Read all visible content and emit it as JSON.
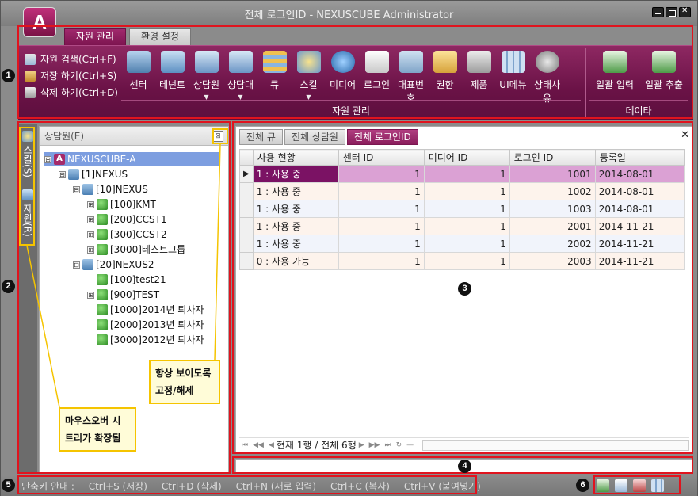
{
  "window": {
    "title": "전체 로그인ID - NEXUSCUBE Administrator",
    "logo": "A"
  },
  "main_tabs": [
    "자원 관리",
    "환경 설정"
  ],
  "ribbon": {
    "small_cmds": [
      "자원 검색(Ctrl+F)",
      "저장 하기(Ctrl+S)",
      "삭제 하기(Ctrl+D)"
    ],
    "big_buttons": [
      "센터",
      "테넌트",
      "상담원",
      "상담대",
      "큐",
      "스킬",
      "미디어",
      "로그인",
      "대표번호",
      "권한",
      "제품",
      "UI메뉴",
      "상태사유"
    ],
    "data_buttons": [
      "일괄 입력",
      "일괄 추출"
    ],
    "group_resource": "자원 관리",
    "group_data": "데이타"
  },
  "left_strip": {
    "skill": "스킬(S)",
    "resource": "자원(R)"
  },
  "tree_panel": {
    "title": "상담원(E)",
    "nodes": [
      {
        "label": "NEXUSCUBE-A",
        "exp": "⊟"
      },
      {
        "label": "[1]NEXUS",
        "exp": "⊟"
      },
      {
        "label": "[10]NEXUS",
        "exp": "⊟"
      },
      {
        "label": "[100]KMT",
        "exp": "⊞"
      },
      {
        "label": "[200]CCST1",
        "exp": "⊞"
      },
      {
        "label": "[300]CCST2",
        "exp": "⊞"
      },
      {
        "label": "[3000]테스트그룹",
        "exp": "⊞"
      },
      {
        "label": "[20]NEXUS2",
        "exp": "⊟"
      },
      {
        "label": "[100]test21",
        "exp": ""
      },
      {
        "label": "[900]TEST",
        "exp": "⊞"
      },
      {
        "label": "[1000]2014년 퇴사자",
        "exp": ""
      },
      {
        "label": "[2000]2013년 퇴사자",
        "exp": ""
      },
      {
        "label": "[3000]2012년 퇴사자",
        "exp": ""
      }
    ]
  },
  "content_tabs": [
    "전체 큐",
    "전체 상담원",
    "전체 로그인ID"
  ],
  "grid": {
    "columns": [
      "사용 현황",
      "센터 ID",
      "미디어 ID",
      "로그인 ID",
      "등록일"
    ],
    "rows": [
      [
        "1 : 사용 중",
        "1",
        "1",
        "1001",
        "2014-08-01"
      ],
      [
        "1 : 사용 중",
        "1",
        "1",
        "1002",
        "2014-08-01"
      ],
      [
        "1 : 사용 중",
        "1",
        "1",
        "1003",
        "2014-08-01"
      ],
      [
        "1 : 사용 중",
        "1",
        "1",
        "2001",
        "2014-11-21"
      ],
      [
        "1 : 사용 중",
        "1",
        "1",
        "2002",
        "2014-11-21"
      ],
      [
        "0 : 사용 가능",
        "1",
        "1",
        "2003",
        "2014-11-21"
      ]
    ],
    "navigator": "현재 1행 / 전체 6행"
  },
  "statusbar": {
    "shortcuts": [
      "단축키 안내   :",
      "Ctrl+S (저장)",
      "Ctrl+D (삭제)",
      "Ctrl+N (새로 입력)",
      "Ctrl+C (복사)",
      "Ctrl+V (붙여넣기)"
    ]
  },
  "callouts": {
    "pin": "항상 보이도록\n고정/해제",
    "mouseover": "마우스오버 시\n트리가 확장됨"
  },
  "badges": [
    "1",
    "2",
    "3",
    "4",
    "5",
    "6"
  ],
  "colors": {
    "ribbon": "#7a1a52",
    "accent": "#a22a6e",
    "highlight": "#e0141e",
    "callout_border": "#f5c400"
  }
}
